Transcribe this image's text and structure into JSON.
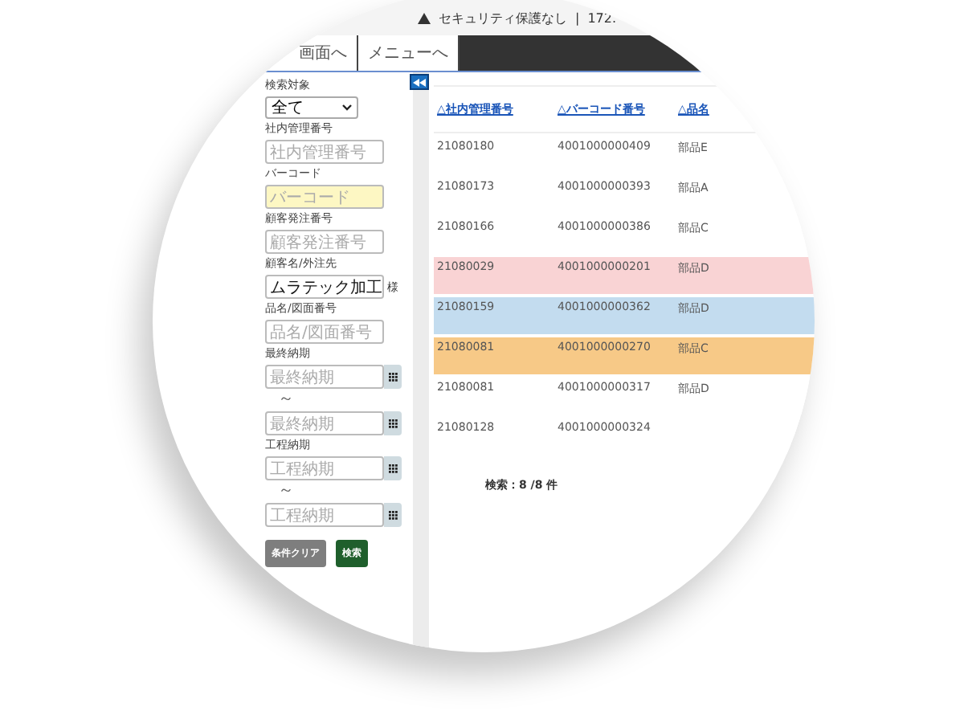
{
  "browser_bar": {
    "security_text": "セキュリティ保護なし",
    "separator": "|",
    "address": "172."
  },
  "nav_tabs": [
    {
      "label": "画面へ"
    },
    {
      "label": "メニューへ"
    }
  ],
  "filters": [
    {
      "kind": "select",
      "label": "検索対象",
      "value": "全て"
    },
    {
      "kind": "text",
      "label": "社内管理番号",
      "placeholder": "社内管理番号",
      "focused": false
    },
    {
      "kind": "text",
      "label": "バーコード",
      "placeholder": "バーコード",
      "focused": true
    },
    {
      "kind": "text",
      "label": "顧客発注番号",
      "placeholder": "顧客発注番号",
      "focused": false
    },
    {
      "kind": "text",
      "label": "顧客名/外注先",
      "value": "ムラテック加工",
      "suffix": "様",
      "focused": false
    },
    {
      "kind": "text",
      "label": "品名/図面番号",
      "placeholder": "品名/図面番号",
      "focused": false
    },
    {
      "kind": "daterange",
      "label": "最終納期",
      "from_placeholder": "最終納期",
      "separator": "～",
      "to_placeholder": "最終納期"
    },
    {
      "kind": "daterange",
      "label": "工程納期",
      "from_placeholder": "工程納期",
      "separator": "～",
      "to_placeholder": "工程納期"
    }
  ],
  "buttons": [
    {
      "kind": "clear",
      "label": "条件クリア"
    },
    {
      "kind": "search",
      "label": "検索"
    }
  ],
  "table": {
    "columns": [
      "△社内管理番号",
      "△バーコード番号",
      "△品名"
    ],
    "rows": [
      {
        "cells": [
          "21080180",
          "4001000000409",
          "部品E"
        ],
        "color": "#ffffff"
      },
      {
        "cells": [
          "21080173",
          "4001000000393",
          "部品A"
        ],
        "color": "#ffffff"
      },
      {
        "cells": [
          "21080166",
          "4001000000386",
          "部品C"
        ],
        "color": "#ffffff"
      },
      {
        "cells": [
          "21080029",
          "4001000000201",
          "部品D"
        ],
        "color": "#f9d3d4"
      },
      {
        "cells": [
          "21080159",
          "4001000000362",
          "部品D"
        ],
        "color": "#c3dcef"
      },
      {
        "cells": [
          "21080081",
          "4001000000270",
          "部品C"
        ],
        "color": "#f7c987"
      },
      {
        "cells": [
          "21080081",
          "4001000000317",
          "部品D"
        ],
        "color": "#ffffff"
      },
      {
        "cells": [
          "21080128",
          "4001000000324",
          ""
        ],
        "color": "#ffffff"
      }
    ]
  },
  "result_count": "検索：8 /8 件"
}
